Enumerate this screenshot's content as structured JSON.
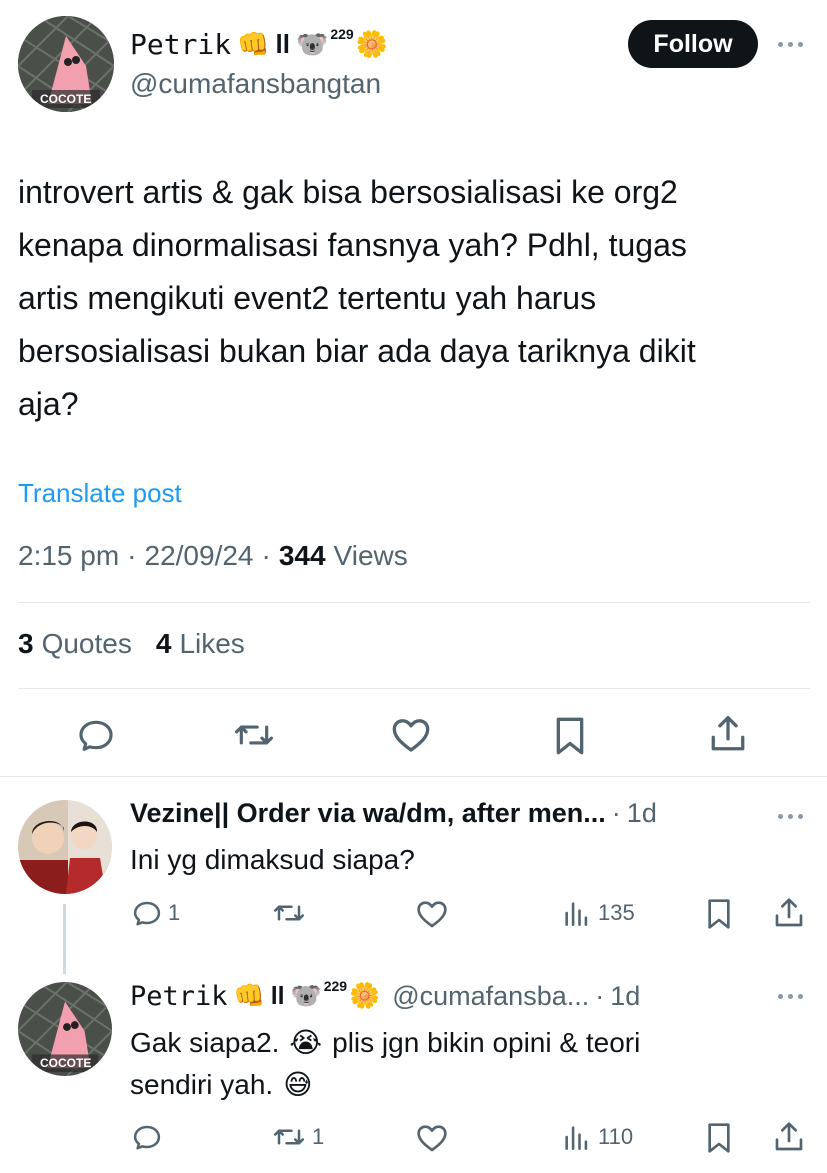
{
  "tweet": {
    "display_name": "Petrik",
    "name_badges": [
      "👊",
      "ll",
      "🐨",
      "229",
      "🌼"
    ],
    "handle": "@cumafansbangtan",
    "follow_label": "Follow",
    "avatar_caption": "COCOTE",
    "text_lines": [
      "introvert artis & gak bisa bersosialisasi ke org2",
      "kenapa dinormalisasi fansnya yah? Pdhl, tugas",
      "artis mengikuti event2 tertentu yah harus",
      "bersosialisasi bukan biar ada daya tariknya dikit",
      "aja?"
    ],
    "translate_label": "Translate post",
    "time": "2:15 pm",
    "date": "22/09/24",
    "views_count": "344",
    "views_label": "Views",
    "quotes_count": "3",
    "quotes_label": "Quotes",
    "likes_count": "4",
    "likes_label": "Likes"
  },
  "replies": [
    {
      "display_name": "Vezine|| Order via wa/dm, after men...",
      "time": "1d",
      "text": "Ini yg dimaksud siapa?",
      "reply_count": "1",
      "retweet_count": "",
      "views": "135"
    },
    {
      "display_name": "Petrik",
      "name_badges": [
        "👊",
        "ll",
        "🐨",
        "229",
        "🌼"
      ],
      "handle": "@cumafansba...",
      "time": "1d",
      "text_line1": "Gak siapa2.",
      "emoji1": "😭",
      "text_line1b": "plis jgn bikin opini & teori",
      "text_line2": "sendiri yah.",
      "emoji2": "😅",
      "avatar_caption": "COCOTE",
      "reply_count": "",
      "retweet_count": "1",
      "views": "110"
    }
  ],
  "colors": {
    "text": "#0f1419",
    "muted": "#536471",
    "link": "#1d9bf0",
    "divider": "#e6e9eb"
  }
}
